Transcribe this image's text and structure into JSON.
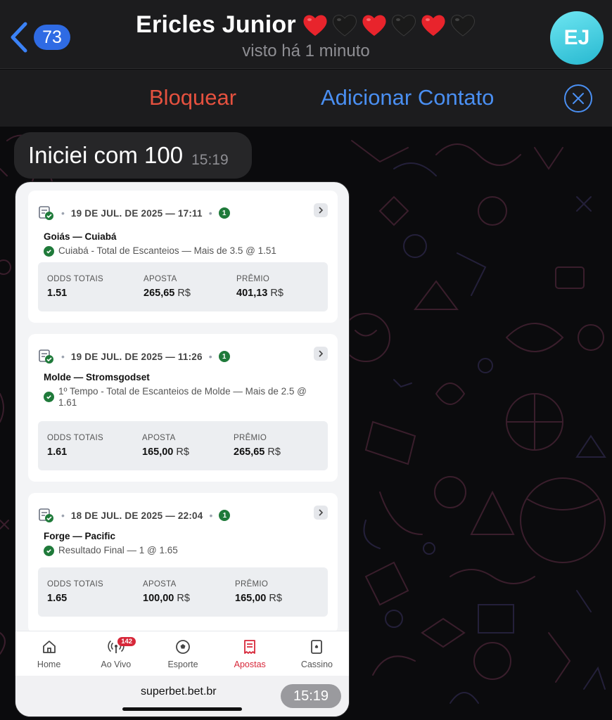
{
  "header": {
    "back_badge": "73",
    "contact_name": "Ericles Junior",
    "hearts": [
      "red-heart",
      "black-heart",
      "red-heart",
      "black-heart",
      "red-heart",
      "black-heart"
    ],
    "last_seen": "visto há 1 minuto",
    "avatar_initials": "EJ"
  },
  "action_bar": {
    "block_label": "Bloquear",
    "add_contact_label": "Adicionar Contato"
  },
  "message": {
    "text": "Iniciei com 100",
    "time": "15:19"
  },
  "screenshot": {
    "bets": [
      {
        "date": "19 DE JUL. DE 2025 — 17:11",
        "count": "1",
        "match": "Goiás — Cuiabá",
        "selection": "Cuiabá - Total de Escanteios — Mais de 3.5 @ 1.51",
        "odds_label": "ODDS TOTAIS",
        "odds": "1.51",
        "stake_label": "APOSTA",
        "stake": "265,65",
        "prize_label": "PRÊMIO",
        "prize": "401,13",
        "currency": "R$"
      },
      {
        "date": "19 DE JUL. DE 2025 — 11:26",
        "count": "1",
        "match": "Molde — Stromsgodset",
        "selection": "1º Tempo - Total de Escanteios de Molde — Mais de 2.5 @ 1.61",
        "odds_label": "ODDS TOTAIS",
        "odds": "1.61",
        "stake_label": "APOSTA",
        "stake": "165,00",
        "prize_label": "PRÊMIO",
        "prize": "265,65",
        "currency": "R$"
      },
      {
        "date": "18 DE JUL. DE 2025 — 22:04",
        "count": "1",
        "match": "Forge — Pacific",
        "selection": "Resultado Final — 1 @ 1.65",
        "odds_label": "ODDS TOTAIS",
        "odds": "1.65",
        "stake_label": "APOSTA",
        "stake": "100,00",
        "prize_label": "PRÊMIO",
        "prize": "165,00",
        "currency": "R$"
      }
    ],
    "tabs": [
      {
        "label": "Home",
        "icon": "home-icon"
      },
      {
        "label": "Ao Vivo",
        "icon": "live-broadcast-icon",
        "badge": "142"
      },
      {
        "label": "Esporte",
        "icon": "soccer-ball-icon"
      },
      {
        "label": "Apostas",
        "icon": "bet-slip-icon",
        "active": true
      },
      {
        "label": "Cassino",
        "icon": "playing-card-icon"
      }
    ],
    "url": "superbet.bet.br",
    "time": "15:19"
  },
  "colors": {
    "accent_blue": "#4a8ff2",
    "block_red": "#e5513f",
    "badge_blue": "#2f6be4",
    "win_green": "#1f7a3a",
    "active_tab_red": "#d7283a"
  }
}
